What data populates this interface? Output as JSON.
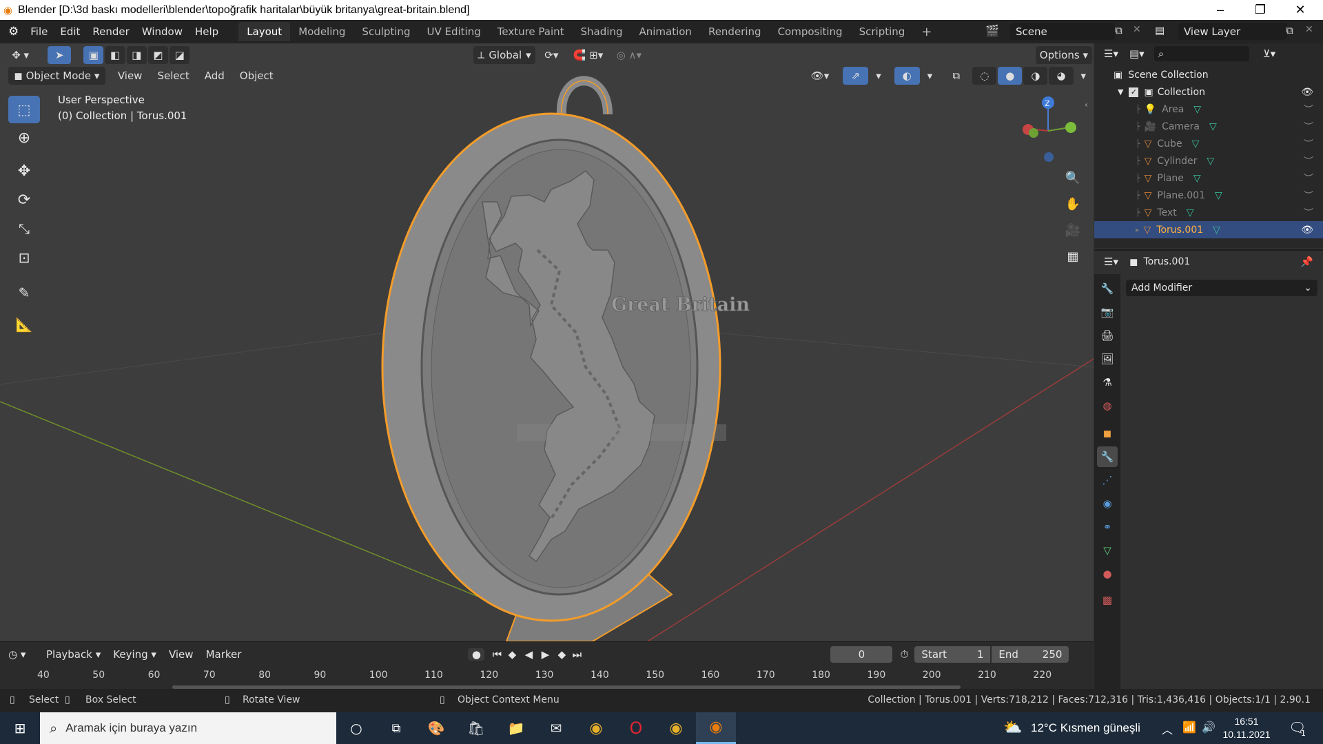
{
  "window": {
    "title": "Blender [D:\\3d baskı modelleri\\blender\\topoğrafik haritalar\\büyük britanya\\great-britain.blend]",
    "minimize": "–",
    "maximize": "❐",
    "close": "✕"
  },
  "menu": {
    "items": [
      "File",
      "Edit",
      "Render",
      "Window",
      "Help"
    ]
  },
  "workspaces": {
    "active": "Layout",
    "tabs": [
      "Layout",
      "Modeling",
      "Sculpting",
      "UV Editing",
      "Texture Paint",
      "Shading",
      "Animation",
      "Rendering",
      "Compositing",
      "Scripting"
    ],
    "add": "+"
  },
  "scene": {
    "label": "Scene",
    "view_layer": "View Layer"
  },
  "viewport": {
    "mode": "Object Mode",
    "menus": [
      "View",
      "Select",
      "Add",
      "Object"
    ],
    "orientation": "Global",
    "options": "Options",
    "perspective_label": "User Perspective",
    "collection_label": "(0) Collection | Torus.001",
    "model_text": "Great Britain",
    "gizmo_axis_z": "Z",
    "colors": {
      "selection_outline": "#f39c2a",
      "x_axis": "#9c3b3b",
      "y_axis": "#6f8f2a",
      "model": "#8a8a8a"
    }
  },
  "timeline": {
    "menus": [
      "Playback",
      "Keying",
      "View",
      "Marker"
    ],
    "current_frame": "0",
    "start_label": "Start",
    "start_value": "1",
    "end_label": "End",
    "end_value": "250",
    "ruler": [
      "40",
      "50",
      "60",
      "70",
      "80",
      "90",
      "100",
      "110",
      "120",
      "130",
      "140",
      "150",
      "160",
      "170",
      "180",
      "190",
      "200",
      "210",
      "220"
    ]
  },
  "status": {
    "select": "Select",
    "box_select": "Box Select",
    "rotate_view": "Rotate View",
    "context_menu": "Object Context Menu",
    "stats": "Collection | Torus.001 | Verts:718,212 | Faces:712,316 | Tris:1,436,416 | Objects:1/1 | 2.90.1"
  },
  "outliner": {
    "scene_collection": "Scene Collection",
    "collection": "Collection",
    "items": [
      "Area",
      "Camera",
      "Cube",
      "Cylinder",
      "Plane",
      "Plane.001",
      "Text",
      "Torus.001"
    ],
    "selected": "Torus.001"
  },
  "properties": {
    "object_name": "Torus.001",
    "add_modifier": "Add Modifier"
  },
  "taskbar": {
    "search_placeholder": "Aramak için buraya yazın",
    "weather": "12°C  Kısmen güneşli",
    "time": "16:51",
    "date": "10.11.2021",
    "notification_count": "1",
    "colors": {
      "background": "#1c2a3a",
      "accent": "#76b9ed"
    }
  }
}
